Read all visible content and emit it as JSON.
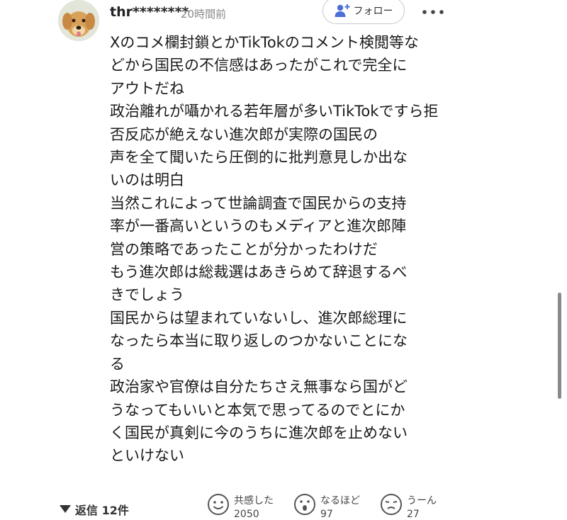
{
  "comment": {
    "username": "thr********",
    "time": "20時間前",
    "follow_label": "フォロー",
    "lines": [
      "Xのコメ欄封鎖とかTikTokのコメント検閲等な",
      "どから国民の不信感はあったがこれで完全に",
      "アウトだね",
      "政治離れが囁かれる若年層が多いTikTokですら拒否反応が絶えない進次郎が実際の国民の",
      "声を全て聞いたら圧倒的に批判意見しか出な",
      "いのは明白",
      "当然これによって世論調査で国民からの支持",
      "率が一番高いというのもメディアと進次郎陣",
      "営の策略であったことが分かったわけだ",
      "もう進次郎は総裁選はあきらめて辞退するべ",
      "きでしょう",
      "国民からは望まれていないし、進次郎総理に",
      "なったら本当に取り返しのつかないことにな",
      "る",
      "政治家や官僚は自分たちさえ無事なら国がど",
      "うなってもいいと本気で思ってるのでとにか",
      "く国民が真剣に今のうちに進次郎を止めない",
      "といけない"
    ]
  },
  "footer": {
    "replies_label": "返信 12件",
    "reactions": [
      {
        "label": "共感した",
        "count": "2050",
        "icon": "smile-face-icon"
      },
      {
        "label": "なるほど",
        "count": "97",
        "icon": "surprised-face-icon"
      },
      {
        "label": "うーん",
        "count": "27",
        "icon": "hmm-face-icon"
      }
    ]
  }
}
